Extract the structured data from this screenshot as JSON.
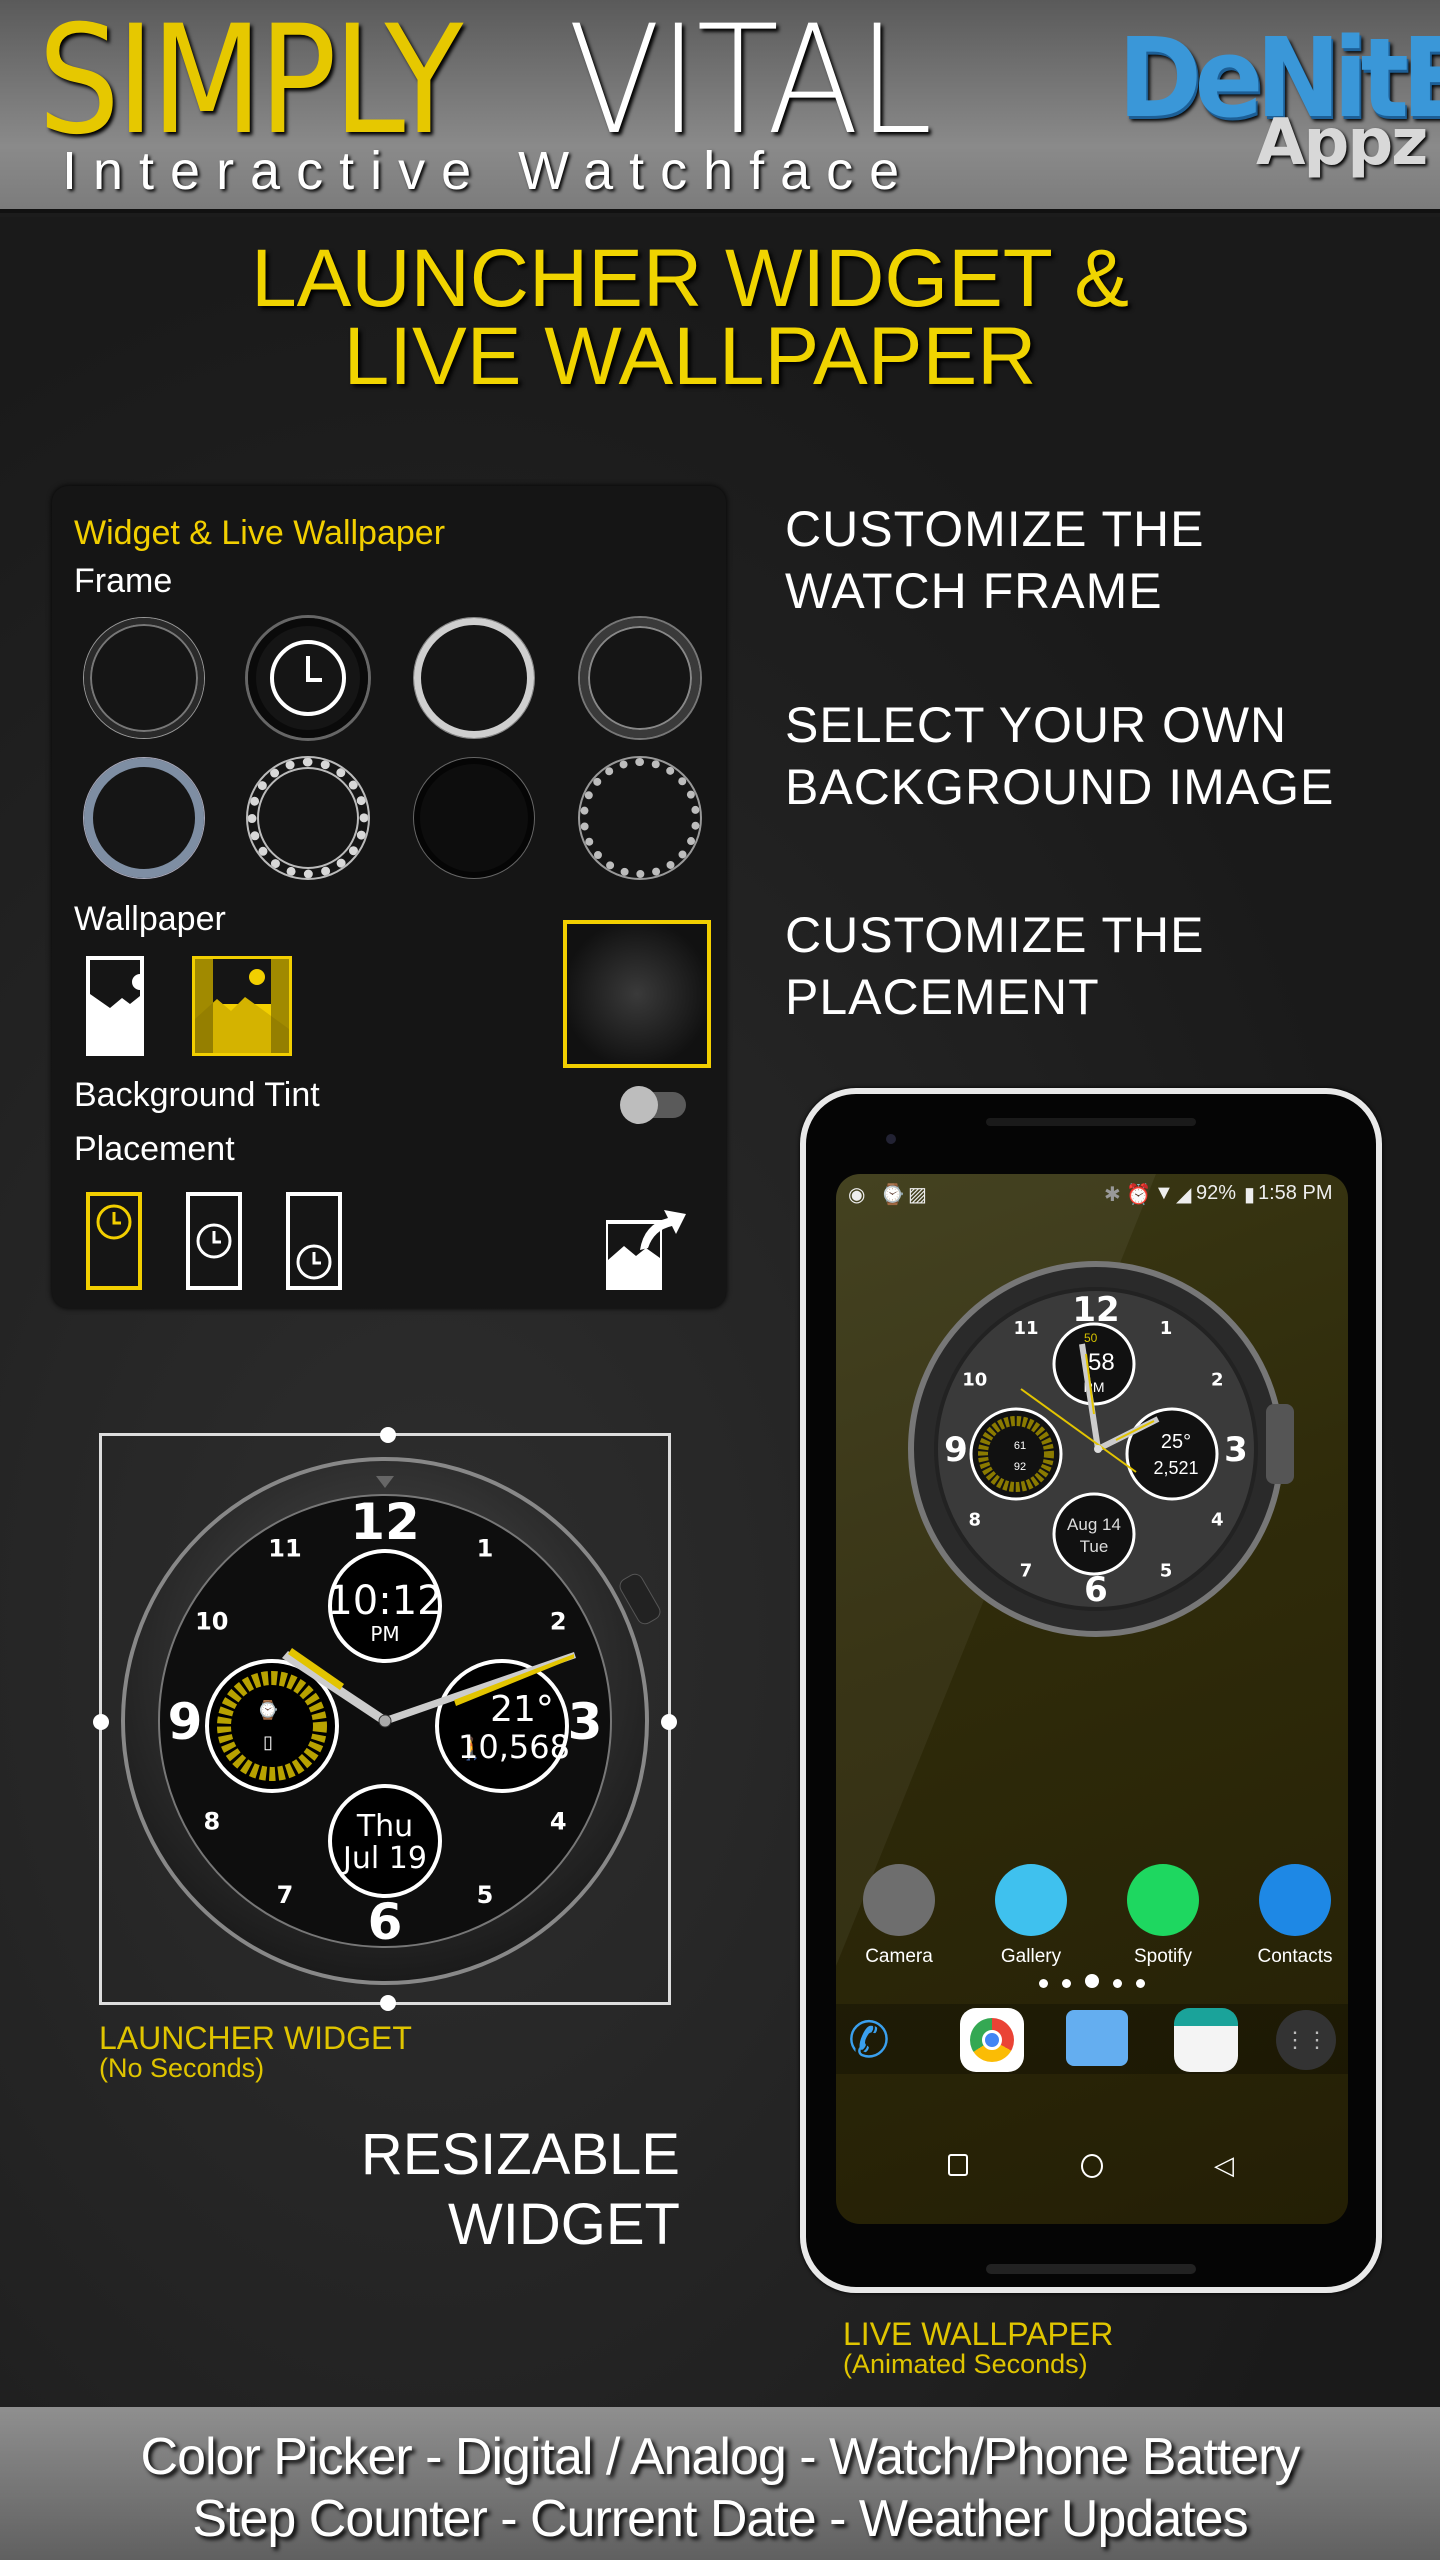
{
  "header": {
    "title_part1": "SIMPLY",
    "title_part2": "VITAL",
    "subtitle": "Interactive Watchface",
    "brand_name": "DeNitE!",
    "brand_sub": "Appz"
  },
  "headline": {
    "line1": "LAUNCHER WIDGET &",
    "line2": "LIVE WALLPAPER"
  },
  "settings_panel": {
    "title": "Widget & Live Wallpaper",
    "frame_label": "Frame",
    "frames": [
      {
        "style": "black-bezel"
      },
      {
        "style": "chrono-selected"
      },
      {
        "style": "silver"
      },
      {
        "style": "dark-chrome"
      },
      {
        "style": "blue-steel"
      },
      {
        "style": "diamond-silver"
      },
      {
        "style": "matte-black"
      },
      {
        "style": "knurled-silver"
      }
    ],
    "wallpaper_label": "Wallpaper",
    "wallpaper_options": [
      "crop-image",
      "fit-image-selected"
    ],
    "background_tint_label": "Background Tint",
    "background_tint_on": false,
    "placement_label": "Placement",
    "placement_options": [
      "top-selected",
      "center",
      "bottom"
    ],
    "accent_color": "#f2cf00"
  },
  "features": [
    {
      "line1": "CUSTOMIZE THE",
      "line2": "WATCH FRAME"
    },
    {
      "line1": "SELECT YOUR OWN",
      "line2": "BACKGROUND IMAGE"
    },
    {
      "line1": "CUSTOMIZE THE",
      "line2": "PLACEMENT"
    }
  ],
  "widget_watch": {
    "numerals": [
      "12",
      "1",
      "2",
      "3",
      "4",
      "5",
      "6",
      "7",
      "8",
      "9",
      "10",
      "11"
    ],
    "digital_time": "10:12",
    "ampm": "PM",
    "temperature": "21°",
    "steps": "10,568",
    "day": "Thu",
    "date": "Jul 19",
    "battery_scale": [
      "0",
      "20",
      "40",
      "60",
      "80",
      "100",
      "80",
      "60",
      "40",
      "20"
    ],
    "caption_title": "LAUNCHER WIDGET",
    "caption_sub": "(No Seconds)"
  },
  "resizable": {
    "line1": "RESIZABLE",
    "line2": "WIDGET"
  },
  "phone": {
    "status_bar": {
      "battery": "92%",
      "time": "1:58 PM"
    },
    "wallpaper_watch": {
      "digital_seconds": "50",
      "digital_time": ":58",
      "ampm": "PM",
      "temperature": "25°",
      "steps": "2,521",
      "watch_battery": "61",
      "phone_battery": "92",
      "date": "Aug 14",
      "day": "Tue"
    },
    "apps": [
      {
        "label": "Camera",
        "color": "#6e6e6e"
      },
      {
        "label": "Gallery",
        "color": "#3fc1ee"
      },
      {
        "label": "Spotify",
        "color": "#1ed760"
      },
      {
        "label": "Contacts",
        "color": "#1e88e5"
      }
    ],
    "page_dots": 5,
    "active_page": 3,
    "dock": [
      "phone",
      "chrome",
      "messages",
      "email",
      "app-drawer"
    ],
    "caption_title": "LIVE WALLPAPER",
    "caption_sub": "(Animated Seconds)"
  },
  "footer": {
    "line1": "Color Picker - Digital / Analog - Watch/Phone Battery",
    "line2": "Step Counter - Current Date - Weather Updates"
  }
}
